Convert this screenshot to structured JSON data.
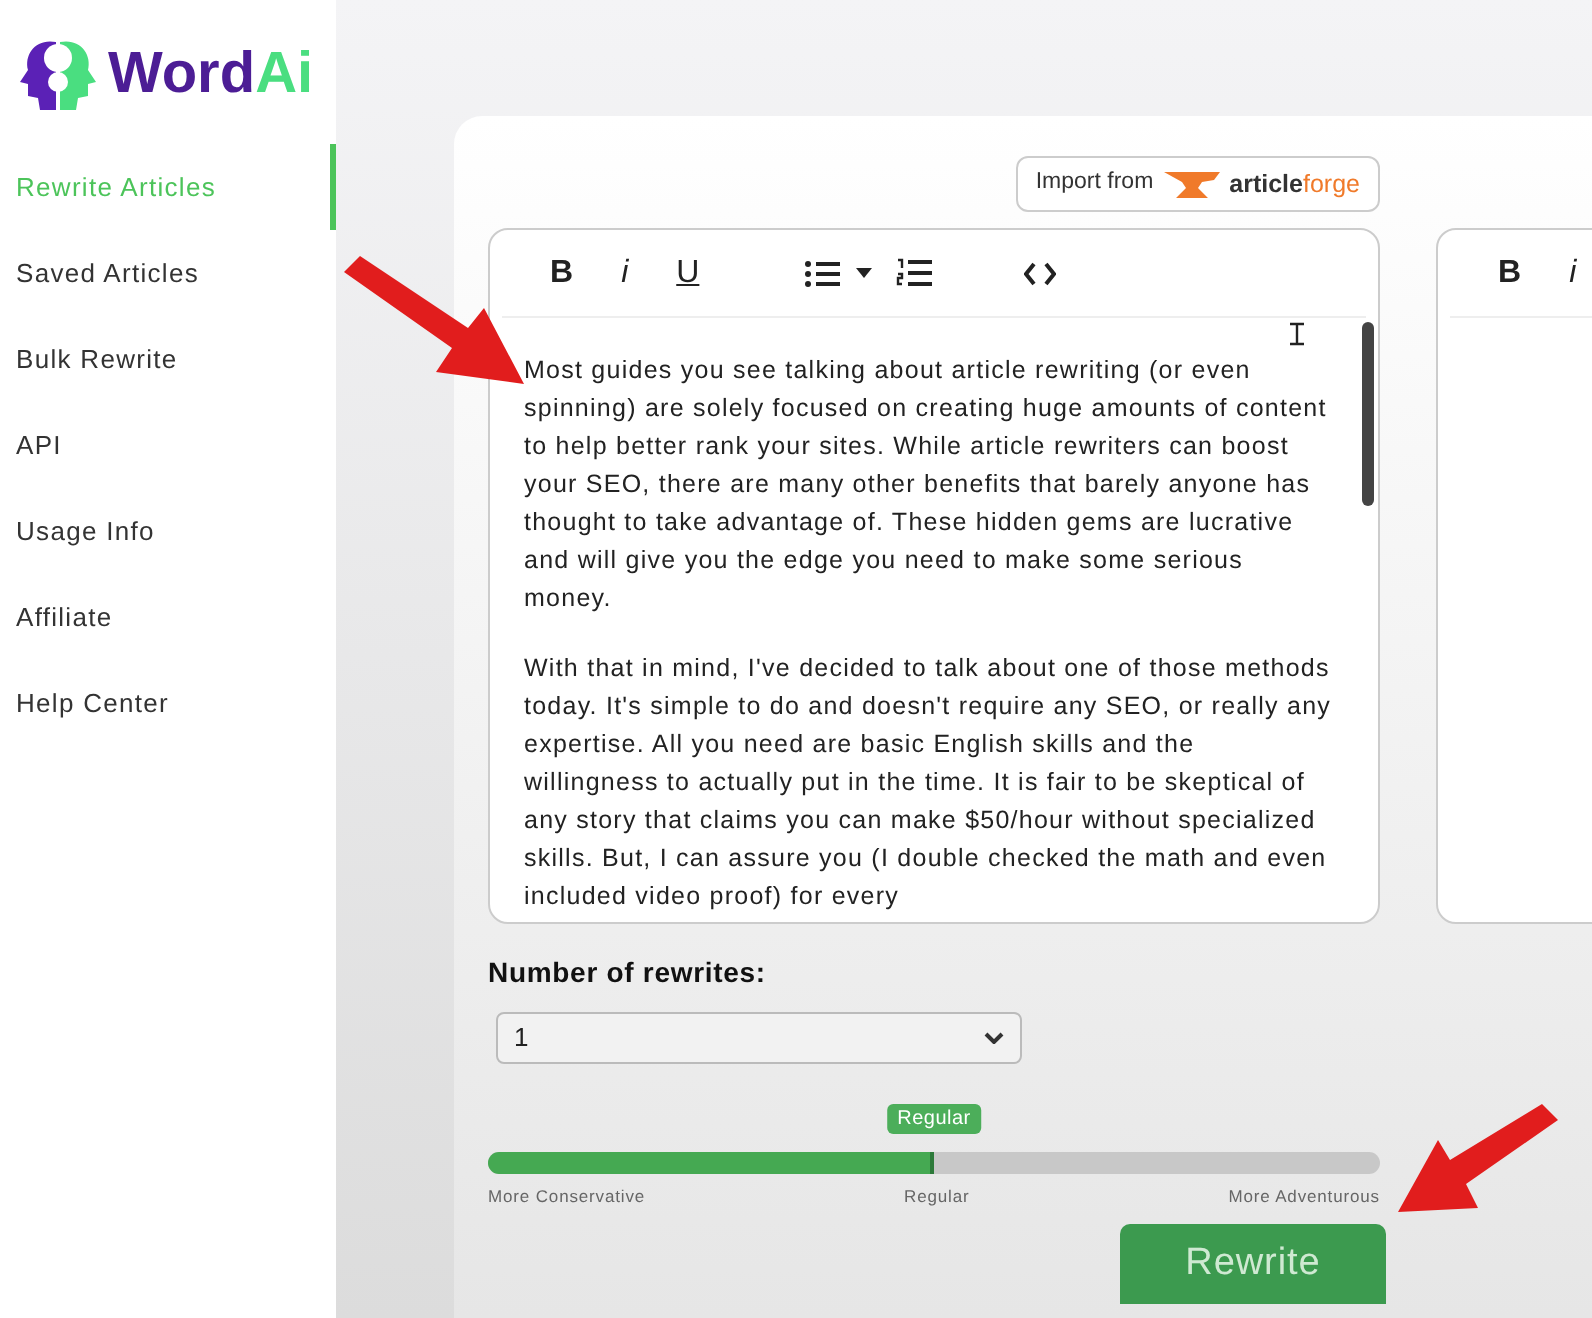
{
  "logo": {
    "text_1": "Word",
    "text_2": "Ai"
  },
  "sidebar": {
    "items": [
      {
        "label": "Rewrite Articles",
        "selected": true
      },
      {
        "label": "Saved Articles",
        "selected": false
      },
      {
        "label": "Bulk Rewrite",
        "selected": false
      },
      {
        "label": "API",
        "selected": false
      },
      {
        "label": "Usage Info",
        "selected": false
      },
      {
        "label": "Affiliate",
        "selected": false
      },
      {
        "label": "Help Center",
        "selected": false
      }
    ]
  },
  "import_button": {
    "label": "Import from",
    "brand_1": "article",
    "brand_2": "forge"
  },
  "editors": [
    {
      "toolbar": [
        {
          "kind": "text",
          "label": "B"
        },
        {
          "kind": "text",
          "label": "i"
        },
        {
          "kind": "text",
          "label": "U"
        },
        {
          "kind": "bullet-list"
        },
        {
          "kind": "dropdown"
        },
        {
          "kind": "numbered-list"
        },
        {
          "kind": "code"
        }
      ],
      "paragraphs": [
        "Most guides you see talking about article rewriting (or even spinning) are solely focused on creating huge amounts of content to help better rank your sites. While article rewriters can boost your SEO, there are many other benefits that barely anyone has thought to take advantage of. These hidden gems are lucrative and will give you the edge you need to make some serious money.",
        "With that in mind, I've decided to talk about one of those methods today. It's simple to do and doesn't require any SEO, or really any expertise. All you need are basic English skills and the willingness to actually put in the time. It is fair to be skeptical of any story that claims you can make $50/hour without specialized skills. But, I can assure you (I double checked the math and even included video proof) for every"
      ]
    },
    {
      "toolbar": [
        {
          "kind": "text",
          "label": "B"
        },
        {
          "kind": "text",
          "label": "i"
        }
      ]
    }
  ],
  "rewrites": {
    "label": "Number of rewrites:",
    "value": "1"
  },
  "slider": {
    "tooltip": "Regular",
    "level": 0.5,
    "ticks": [
      "More Conservative",
      "Regular",
      "More Adventurous"
    ]
  },
  "rewrite_button": {
    "label": "Rewrite"
  }
}
